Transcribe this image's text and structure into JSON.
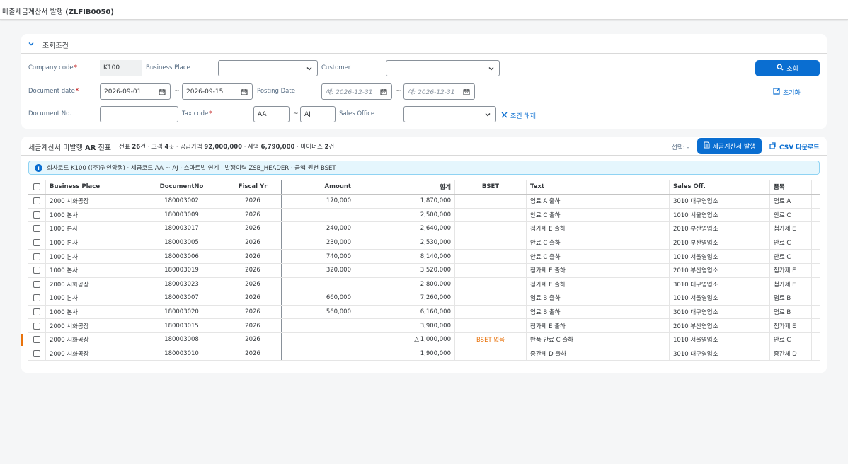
{
  "app": {
    "title_prefix": "매출세금계산서 발행 ",
    "title_code": "(ZLFIB0050)"
  },
  "filter": {
    "title": "조회조건",
    "company_code": {
      "label": "Company code",
      "value": "K100"
    },
    "business_place": {
      "label": "Business Place",
      "value": ""
    },
    "customer": {
      "label": "Customer",
      "value": ""
    },
    "document_date": {
      "label": "Document date",
      "from": "2026-09-01",
      "to": "2026-09-15"
    },
    "posting_date": {
      "label": "Posting Date",
      "from_placeholder": "예: 2026-12-31",
      "to_placeholder": "예: 2026-12-31"
    },
    "document_no": {
      "label": "Document No.",
      "value": ""
    },
    "tax_code": {
      "label": "Tax code",
      "from": "AA",
      "to": "AJ"
    },
    "sales_office": {
      "label": "Sales Office",
      "value": ""
    },
    "range_sep": "~",
    "clear_label": "조건 해제",
    "search_label": "조회",
    "reset_label": "초기화"
  },
  "table": {
    "title_prefix": "세금계산서 미발행 ",
    "title_bold": "AR",
    "title_suffix": " 전표",
    "summary": {
      "docs_label": "전표 ",
      "docs_count": "26",
      "docs_unit": "건 · 고객 ",
      "cust_count": "4",
      "cust_unit": "곳 · 공급가액 ",
      "supply_amount": "92,000,000",
      "tax_label": " · 세액 ",
      "tax_amount": "6,790,000",
      "minus_label": " · 마이너스 ",
      "minus_count": "2",
      "minus_unit": "건"
    },
    "selection_label": "선택: -",
    "issue_label": "세금계산서 발행",
    "csv_label": "CSV 다운로드",
    "info_text": "회사코드 K100 ((주)경인양행) · 세금코드 AA ~ AJ · 스마트빌 연계 · 발행이력 ZSB_HEADER · 금액 원천 BSET",
    "columns": [
      "Business Place",
      "DocumentNo",
      "Fiscal Yr",
      "Amount",
      "합계",
      "BSET",
      "Text",
      "Sales Off.",
      "품목"
    ],
    "rows": [
      {
        "bp": "2000 시화공장",
        "doc": "180003002",
        "fy": "2026",
        "amount": "170,000",
        "total": "1,870,000",
        "bset": "",
        "text": "염료 A 출하",
        "so": "3010 대구영업소",
        "item": "염료 A",
        "flag": false
      },
      {
        "bp": "1000 본사",
        "doc": "180003009",
        "fy": "2026",
        "amount": "",
        "total": "2,500,000",
        "bset": "",
        "text": "안료 C 출하",
        "so": "1010 서울영업소",
        "item": "안료 C",
        "flag": false
      },
      {
        "bp": "1000 본사",
        "doc": "180003017",
        "fy": "2026",
        "amount": "240,000",
        "total": "2,640,000",
        "bset": "",
        "text": "첨가제 E 출하",
        "so": "2010 부산영업소",
        "item": "첨가제 E",
        "flag": false
      },
      {
        "bp": "1000 본사",
        "doc": "180003005",
        "fy": "2026",
        "amount": "230,000",
        "total": "2,530,000",
        "bset": "",
        "text": "안료 C 출하",
        "so": "2010 부산영업소",
        "item": "안료 C",
        "flag": false
      },
      {
        "bp": "1000 본사",
        "doc": "180003006",
        "fy": "2026",
        "amount": "740,000",
        "total": "8,140,000",
        "bset": "",
        "text": "안료 C 출하",
        "so": "1010 서울영업소",
        "item": "안료 C",
        "flag": false
      },
      {
        "bp": "1000 본사",
        "doc": "180003019",
        "fy": "2026",
        "amount": "320,000",
        "total": "3,520,000",
        "bset": "",
        "text": "첨가제 E 출하",
        "so": "2010 부산영업소",
        "item": "첨가제 E",
        "flag": false
      },
      {
        "bp": "2000 시화공장",
        "doc": "180003023",
        "fy": "2026",
        "amount": "",
        "total": "2,800,000",
        "bset": "",
        "text": "첨가제 E 출하",
        "so": "3010 대구영업소",
        "item": "첨가제 E",
        "flag": false
      },
      {
        "bp": "1000 본사",
        "doc": "180003007",
        "fy": "2026",
        "amount": "660,000",
        "total": "7,260,000",
        "bset": "",
        "text": "염료 B 출하",
        "so": "1010 서울영업소",
        "item": "염료 B",
        "flag": false
      },
      {
        "bp": "1000 본사",
        "doc": "180003020",
        "fy": "2026",
        "amount": "560,000",
        "total": "6,160,000",
        "bset": "",
        "text": "염료 B 출하",
        "so": "3010 대구영업소",
        "item": "염료 B",
        "flag": false
      },
      {
        "bp": "2000 시화공장",
        "doc": "180003015",
        "fy": "2026",
        "amount": "",
        "total": "3,900,000",
        "bset": "",
        "text": "첨가제 E 출하",
        "so": "2010 부산영업소",
        "item": "첨가제 E",
        "flag": false
      },
      {
        "bp": "2000 시화공장",
        "doc": "180003008",
        "fy": "2026",
        "amount": "",
        "total": "1,000,000",
        "total_prefix": "△",
        "bset": "BSET 없음",
        "text": "반품 안료 C 출하",
        "so": "1010 서울영업소",
        "item": "안료 C",
        "flag": true
      },
      {
        "bp": "2000 시화공장",
        "doc": "180003010",
        "fy": "2026",
        "amount": "",
        "total": "1,900,000",
        "bset": "",
        "text": "중간체 D 출하",
        "so": "3010 대구영업소",
        "item": "중간체 D",
        "flag": false
      }
    ]
  },
  "colors": {
    "accent": "#0a6ed1",
    "warning": "#e9730c",
    "required": "#bb0000"
  }
}
